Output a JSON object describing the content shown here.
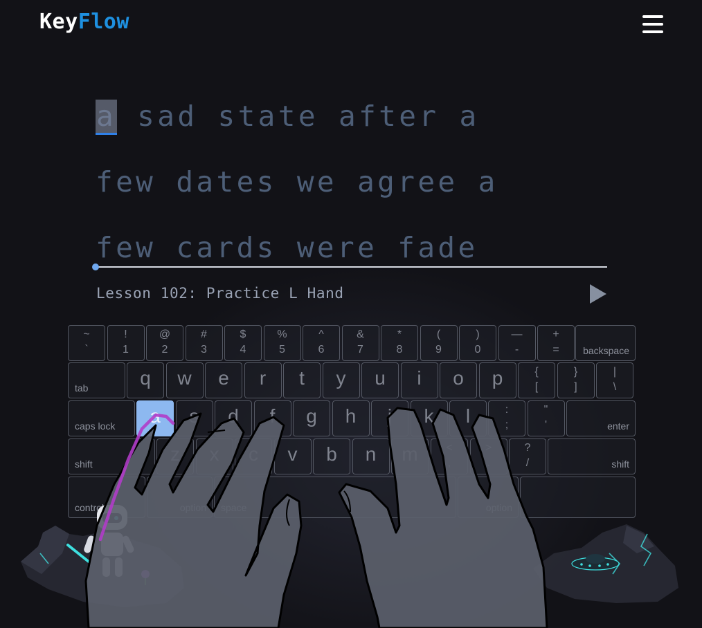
{
  "header": {
    "logo_part1": "Key",
    "logo_part2": "Flow",
    "menu_icon": "hamburger-icon"
  },
  "typing": {
    "lines": [
      {
        "current": "a",
        "rest": " sad state after a"
      },
      {
        "text": "few dates we agree a"
      },
      {
        "text": "few cards were fade"
      }
    ],
    "current_char": "a"
  },
  "lesson": {
    "title": "Lesson 102: Practice L Hand",
    "play_icon": "play-icon"
  },
  "keyboard": {
    "row1": [
      {
        "top": "~",
        "bot": "`"
      },
      {
        "top": "!",
        "bot": "1"
      },
      {
        "top": "@",
        "bot": "2"
      },
      {
        "top": "#",
        "bot": "3"
      },
      {
        "top": "$",
        "bot": "4"
      },
      {
        "top": "%",
        "bot": "5"
      },
      {
        "top": "^",
        "bot": "6"
      },
      {
        "top": "&",
        "bot": "7"
      },
      {
        "top": "*",
        "bot": "8"
      },
      {
        "top": "(",
        "bot": "9"
      },
      {
        "top": ")",
        "bot": "0"
      },
      {
        "top": "—",
        "bot": "-"
      },
      {
        "top": "+",
        "bot": "="
      }
    ],
    "backspace": "backspace",
    "tab": "tab",
    "row2": [
      "q",
      "w",
      "e",
      "r",
      "t",
      "y",
      "u",
      "i",
      "o",
      "p"
    ],
    "row2_sym": [
      {
        "top": "{",
        "bot": "["
      },
      {
        "top": "}",
        "bot": "]"
      },
      {
        "top": "|",
        "bot": "\\"
      }
    ],
    "caps": "caps lock",
    "row3": [
      "a",
      "s",
      "d",
      "f",
      "g",
      "h",
      "j",
      "k",
      "l"
    ],
    "row3_sym": [
      {
        "top": ":",
        "bot": ";"
      },
      {
        "top": "\"",
        "bot": "'"
      }
    ],
    "enter": "enter",
    "shift_left": "shift",
    "row4": [
      "z",
      "x",
      "c",
      "v",
      "b",
      "n",
      "m"
    ],
    "row4_sym": [
      {
        "top": "<",
        "bot": ","
      },
      {
        "top": ">",
        "bot": "."
      },
      {
        "top": "?",
        "bot": "/"
      }
    ],
    "shift_right": "shift",
    "control": "control",
    "option_left": "option",
    "space": "space",
    "option_right": "option",
    "active_key": "a",
    "active_color": "#8db8f0"
  },
  "colors": {
    "background": "#121217",
    "brand_blue": "#1e90e0",
    "text_muted": "#4d5e77",
    "finger_path": "#b03cc8",
    "robot_glow": "#3ee0e0"
  }
}
